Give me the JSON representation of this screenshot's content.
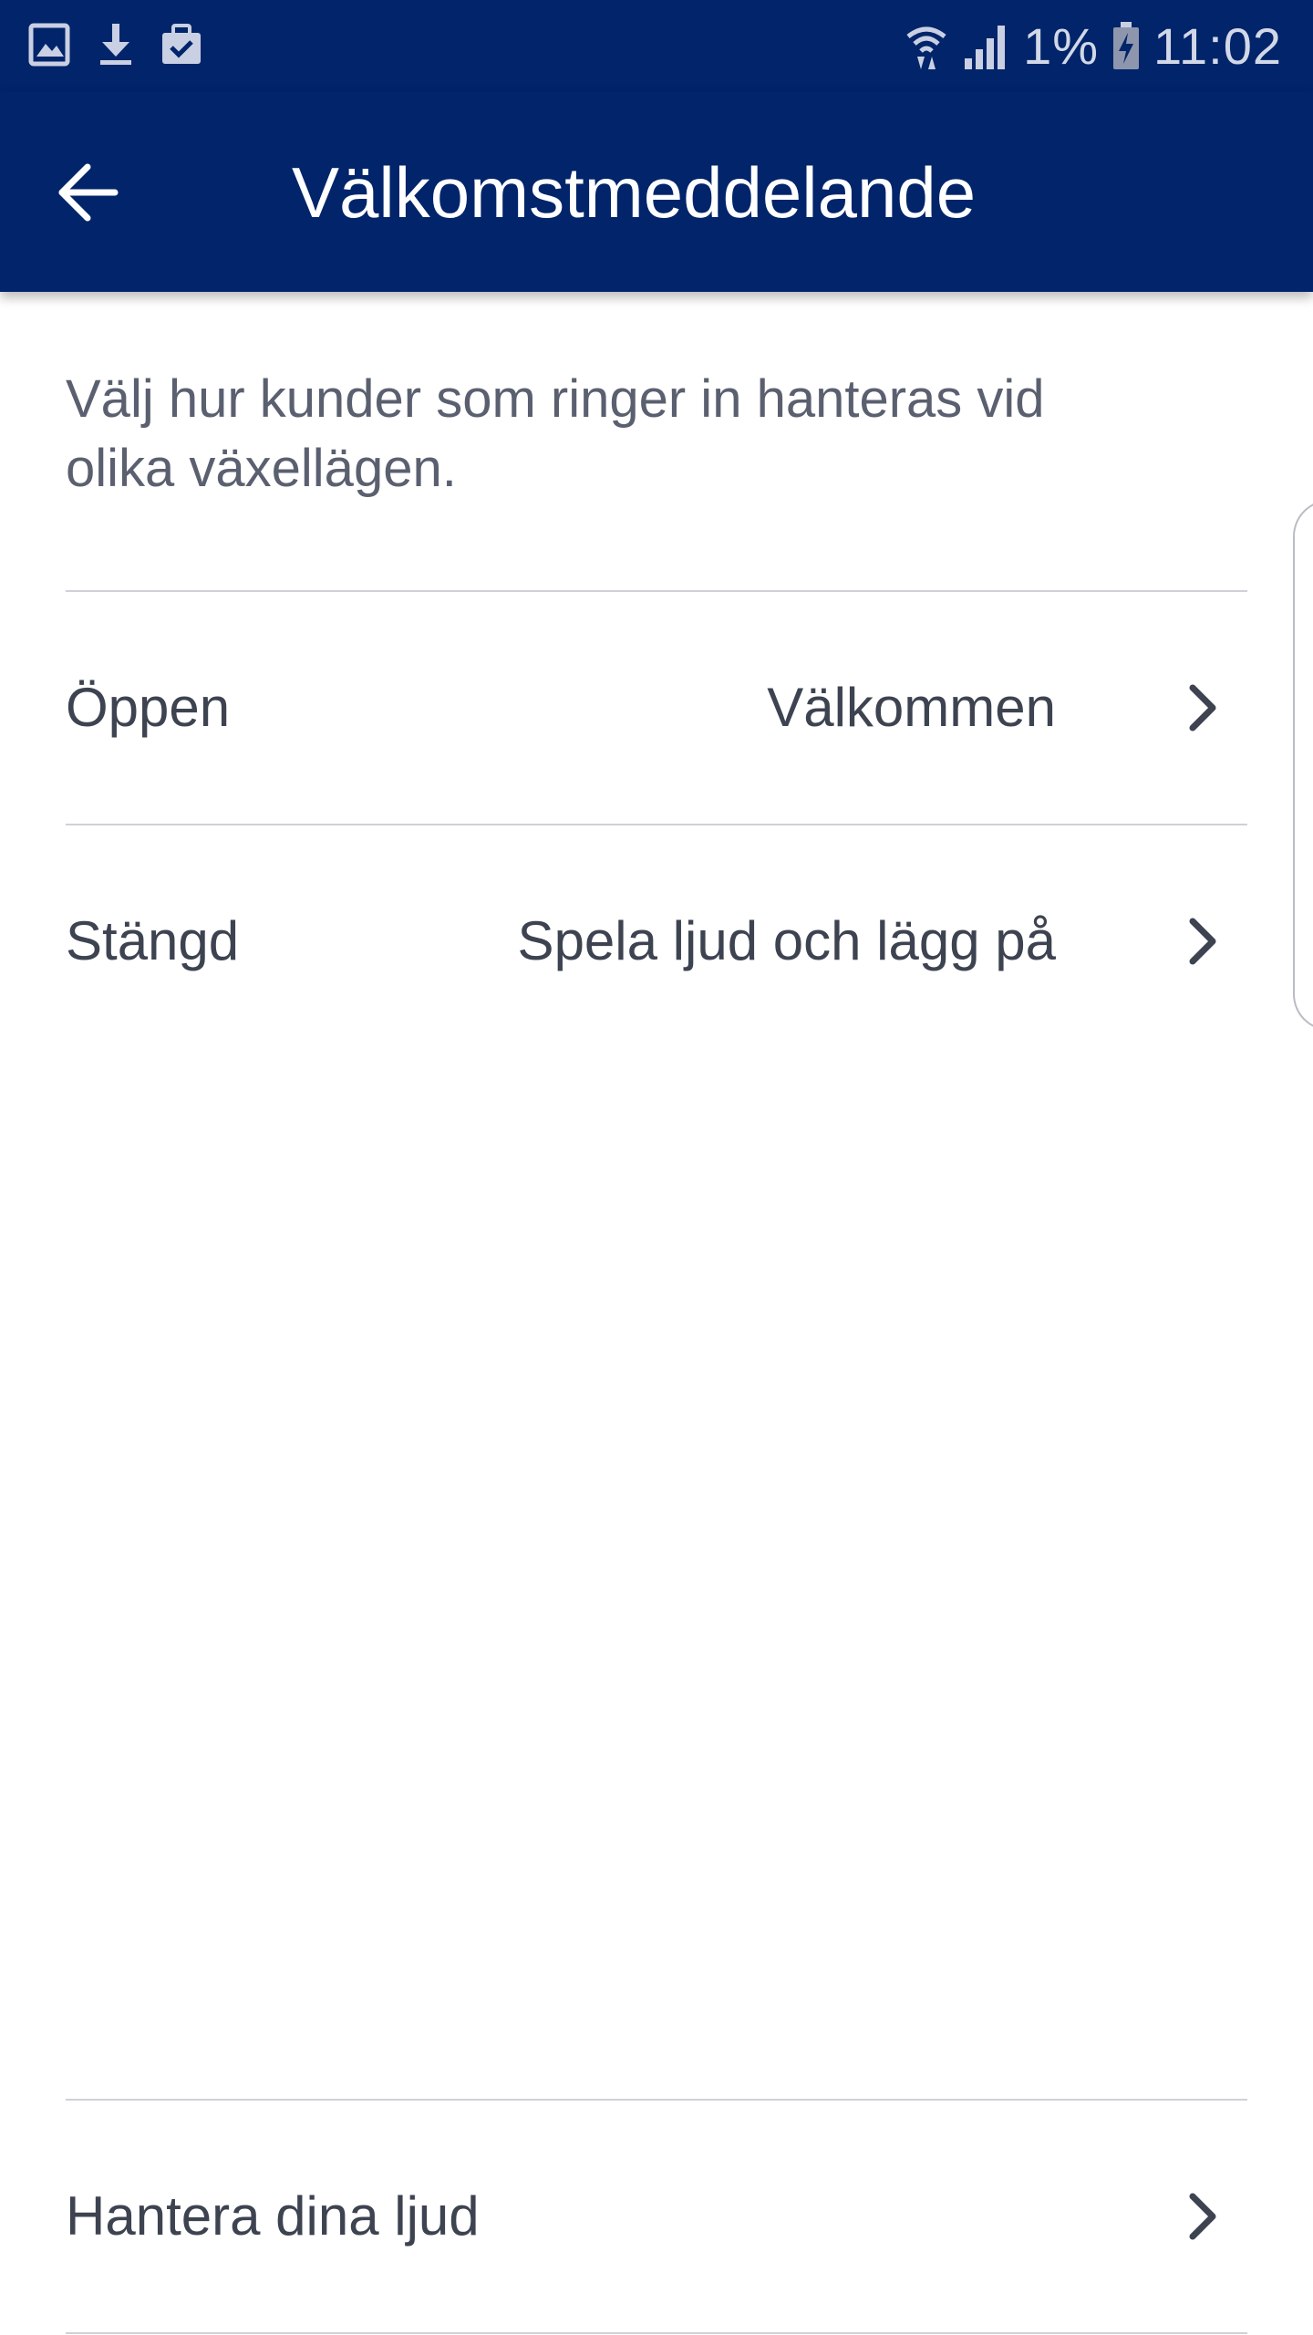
{
  "status_bar": {
    "left_icons": [
      "image-notification-icon",
      "download-notification-icon",
      "briefcase-check-icon"
    ],
    "right_icons": [
      "wifi-data-icon",
      "signal-icon",
      "battery-charging-icon"
    ],
    "battery": "1%",
    "time": "11:02",
    "background": "#01246a"
  },
  "app_bar": {
    "title": "Välkomstmeddelande",
    "back_icon": "arrow-left-icon",
    "background": "#01246a"
  },
  "description": "Välj hur kunder som ringer in hanteras vid olika växellägen.",
  "settings": [
    {
      "label": "Öppen",
      "value": "Välkommen"
    },
    {
      "label": "Stängd",
      "value": "Spela ljud och lägg på"
    }
  ],
  "footer_link": {
    "label": "Hantera dina ljud"
  },
  "colors": {
    "text_primary": "#3d4350",
    "text_secondary": "#5b6070",
    "divider": "#cfd1d6"
  }
}
